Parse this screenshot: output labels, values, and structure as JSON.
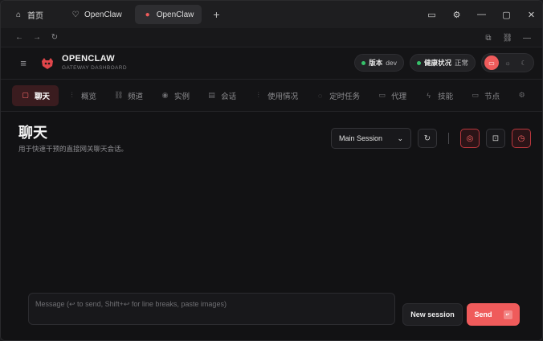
{
  "tabs": [
    {
      "label": "首页",
      "icon": "home-icon",
      "glyph": "⌂",
      "active": false
    },
    {
      "label": "OpenClaw",
      "icon": "claw-icon",
      "glyph": "♡",
      "active": false
    },
    {
      "label": "OpenClaw",
      "icon": "claw-red-icon",
      "glyph": "●",
      "active": true
    }
  ],
  "new_tab": "+",
  "window_controls": {
    "monitor": "▭",
    "settings": "⚙",
    "minimize": "—",
    "maximize": "▢",
    "close": "✕"
  },
  "nav": {
    "back": "←",
    "forward": "→",
    "reload": "↻",
    "open": "⧉",
    "link": "⛓",
    "more": "—"
  },
  "header": {
    "menu": "≡",
    "brand_title": "OPENCLAW",
    "brand_sub": "GATEWAY DASHBOARD",
    "version_key": "版本",
    "version_val": "dev",
    "health_key": "健康状况",
    "health_val": "正常",
    "status_color": "#36c26a",
    "theme": {
      "monitor": "▭",
      "light": "☼",
      "dark": "☾"
    }
  },
  "navtabs": [
    {
      "label": "聊天",
      "icon": "chat-icon",
      "glyph": "▢",
      "active": true
    },
    {
      "label": "概览",
      "icon": "bars-icon",
      "glyph": "⫶",
      "active": false
    },
    {
      "label": "频道",
      "icon": "link-icon",
      "glyph": "⛓",
      "active": false
    },
    {
      "label": "实例",
      "icon": "radio-icon",
      "glyph": "◉",
      "active": false
    },
    {
      "label": "会话",
      "icon": "file-icon",
      "glyph": "▤",
      "active": false
    },
    {
      "label": "使用情况",
      "icon": "usage-icon",
      "glyph": "⫶",
      "active": false
    },
    {
      "label": "定时任务",
      "icon": "timer-icon",
      "glyph": "◌",
      "active": false
    },
    {
      "label": "代理",
      "icon": "folder-icon",
      "glyph": "▭",
      "active": false
    },
    {
      "label": "技能",
      "icon": "bolt-icon",
      "glyph": "ϟ",
      "active": false
    },
    {
      "label": "节点",
      "icon": "monitor-icon",
      "glyph": "▭",
      "active": false
    },
    {
      "label": "",
      "icon": "gear-icon",
      "glyph": "⚙",
      "active": false
    }
  ],
  "page": {
    "title": "聊天",
    "subtitle": "用于快速干预的直接网关聊天会话。",
    "session_select": "Main Session",
    "chevron": "⌄",
    "refresh": "↻",
    "tool_brain": "◎",
    "tool_focus": "⊡",
    "tool_clock": "◷"
  },
  "composer": {
    "placeholder": "Message (↩ to send, Shift+↩ for line breaks, paste images)",
    "new_session": "New session",
    "send": "Send",
    "send_kbd": "↵"
  },
  "colors": {
    "accent": "#ef5b5b",
    "bg": "#121214"
  }
}
